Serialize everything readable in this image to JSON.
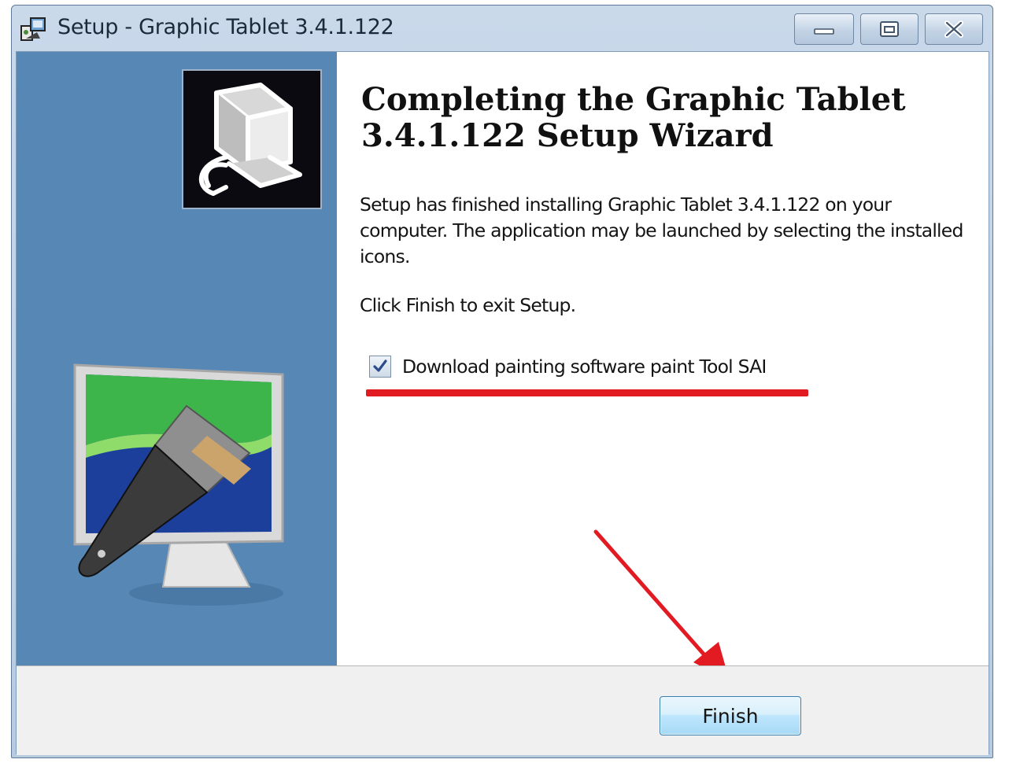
{
  "window": {
    "title": "Setup - Graphic Tablet 3.4.1.122",
    "icons": {
      "app": "setup-app-icon",
      "minimize": "minimize-icon",
      "maximize": "maximize-icon",
      "close": "close-icon"
    }
  },
  "side_panel": {
    "background_color": "#5787b4",
    "images": [
      "setup-computer-logo",
      "monitor-paintbrush-illustration"
    ]
  },
  "content": {
    "heading": "Completing the Graphic Tablet 3.4.1.122 Setup Wizard",
    "paragraph1": "Setup has finished installing Graphic Tablet 3.4.1.122 on your computer. The application may be launched by selecting the installed icons.",
    "paragraph2": "Click Finish to exit Setup.",
    "checkbox": {
      "label": "Download painting software paint Tool SAI",
      "checked": true
    }
  },
  "annotations": {
    "color": "#e21b23",
    "underline": "checkbox-underline",
    "arrow": "arrow-to-finish"
  },
  "footer": {
    "finish_label": "Finish"
  }
}
